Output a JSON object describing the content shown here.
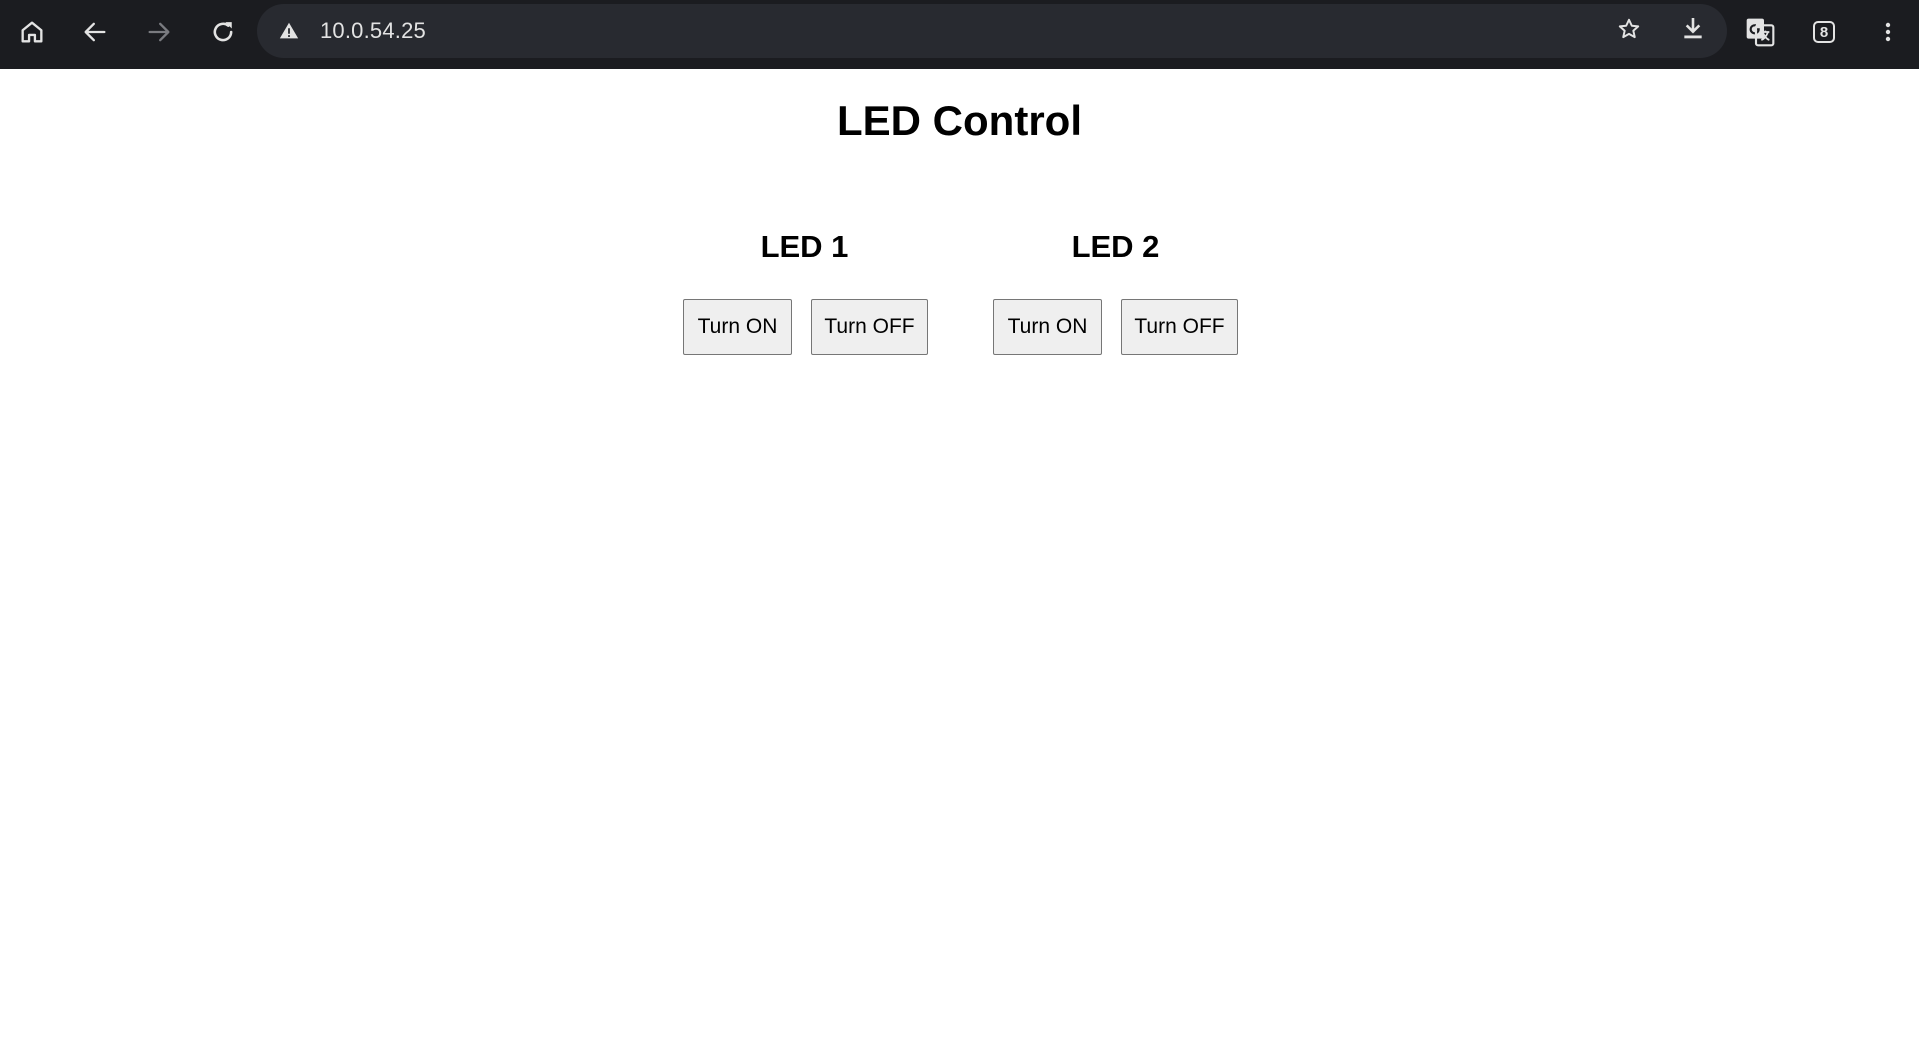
{
  "browser": {
    "url": "10.0.54.25",
    "tab_count": "8",
    "icons": {
      "home": "home-icon",
      "back": "arrow-left-icon",
      "forward": "arrow-right-icon",
      "reload": "reload-icon",
      "security": "warning-triangle-icon",
      "bookmark": "star-icon",
      "download": "download-icon",
      "translate": "translate-icon",
      "tabs": "tab-switcher-icon",
      "menu": "more-vertical-icon"
    },
    "colors": {
      "toolbar_bg": "#1b1c20",
      "omnibox_bg": "#282a30",
      "icon_fg": "#e3e3e3",
      "icon_disabled": "#7a7b80"
    }
  },
  "page": {
    "title": "LED Control",
    "leds": [
      {
        "label": "LED 1",
        "on_label": "Turn ON",
        "off_label": "Turn OFF"
      },
      {
        "label": "LED 2",
        "on_label": "Turn ON",
        "off_label": "Turn OFF"
      }
    ]
  }
}
